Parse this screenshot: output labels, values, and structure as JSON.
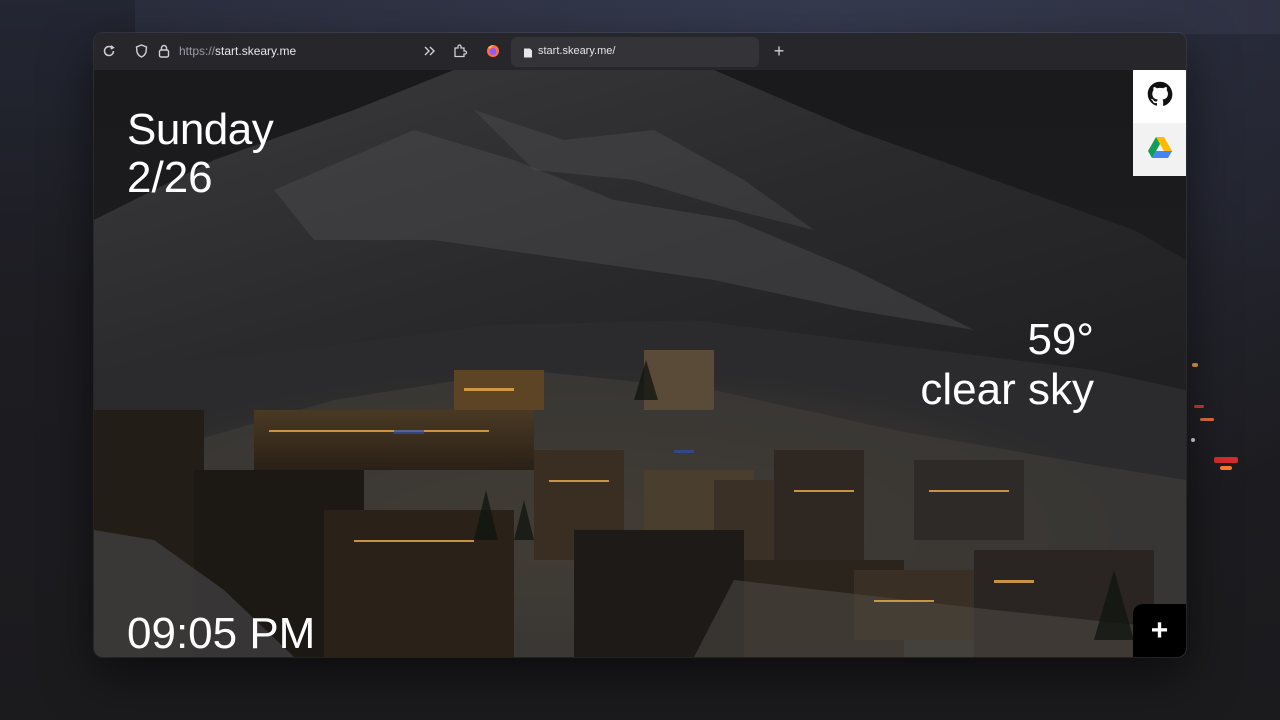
{
  "browser": {
    "url_scheme": "https://",
    "url_host": "start.skeary.me",
    "tab_title": "start.skeary.me/",
    "new_tab_label": "+"
  },
  "startpage": {
    "day": "Sunday",
    "date": "2/26",
    "time": "09:05 PM",
    "temperature": "59°",
    "condition": "clear sky",
    "add_label": "+",
    "shortcuts": [
      {
        "icon": "github-icon"
      },
      {
        "icon": "google-drive-icon"
      }
    ]
  },
  "colors": {
    "text": "#ffffff",
    "toolbar": "#26262b",
    "tab": "#333338"
  }
}
